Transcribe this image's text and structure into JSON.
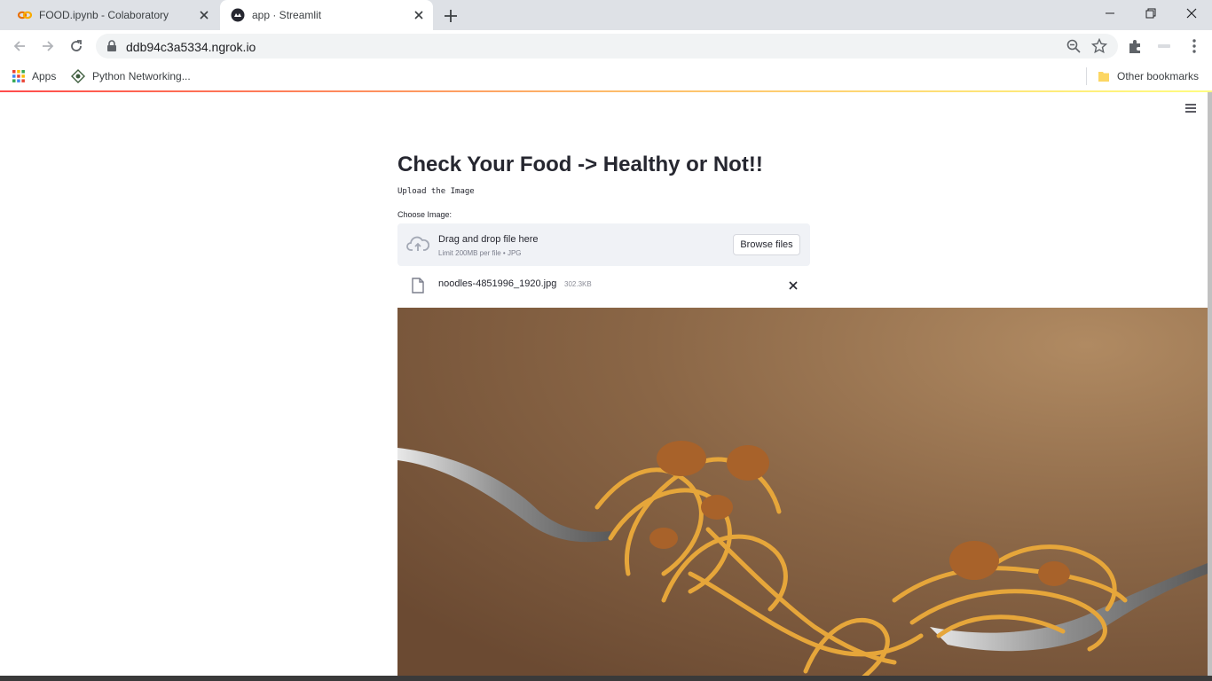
{
  "browser": {
    "tabs": [
      {
        "title": "FOOD.ipynb - Colaboratory",
        "active": false
      },
      {
        "title": "app · Streamlit",
        "active": true
      }
    ],
    "url": "ddb94c3a5334.ngrok.io",
    "bookmarks": {
      "apps": "Apps",
      "python_networking": "Python Networking...",
      "other": "Other bookmarks"
    },
    "accent_colors": {
      "colab_orange": "#f9ab00",
      "streamlit_red": "#ff4b4b",
      "folder_yellow": "#fcd663"
    }
  },
  "app": {
    "title": "Check Your Food -> Healthy or Not!!",
    "subtitle": "Upload the Image",
    "uploader": {
      "label": "Choose Image:",
      "drop_title": "Drag and drop file here",
      "drop_hint": "Limit 200MB per file • JPG",
      "browse_label": "Browse files"
    },
    "file": {
      "name": "noodles-4851996_1920.jpg",
      "size": "302.3KB"
    },
    "image_description_icon": "food-photo"
  }
}
